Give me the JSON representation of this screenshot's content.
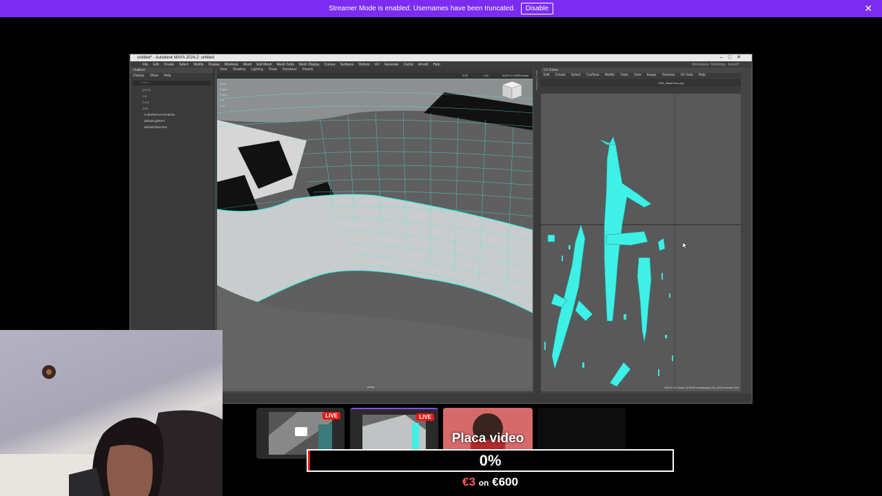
{
  "banner": {
    "message": "Streamer Mode is enabled. Usernames have been truncated.",
    "disable_label": "Disable",
    "close_icon": "close-icon"
  },
  "maya": {
    "title": "untitled* - Autodesk MAYA 2024.2: untitled",
    "menus": [
      "File",
      "Edit",
      "Create",
      "Select",
      "Modify",
      "Display",
      "Windows",
      "Mesh",
      "Edit Mesh",
      "Mesh Tools",
      "Mesh Display",
      "Curves",
      "Surfaces",
      "Deform",
      "UV",
      "Generate",
      "Cache",
      "Arnold",
      "Help"
    ],
    "workspace_label": "Workspace:",
    "workspace_value": "Modeling - Expert*",
    "outliner": {
      "title": "Outliner",
      "menus": [
        "Display",
        "Show",
        "Help"
      ],
      "search_placeholder": "Search...",
      "items": [
        "persp",
        "top",
        "front",
        "side",
        "CubePBX4ACDA6015",
        "defaultLightSet",
        "defaultObjectSet"
      ]
    },
    "viewport": {
      "menus": [
        "View",
        "Shading",
        "Lighting",
        "Show",
        "Renderer",
        "Panels"
      ],
      "hud": [
        "Verts",
        "Edges",
        "Faces",
        "Tris",
        "UVs"
      ],
      "field_a": "0.00",
      "field_b": "1.00",
      "color_space": "ACES 1.0 SDR-video",
      "camera_label": "persp"
    },
    "uv_editor": {
      "title": "UV Editor",
      "menus": [
        "Edit",
        "Create",
        "Select",
        "Cut/Sew",
        "Modify",
        "Tools",
        "View",
        "Image",
        "Textures",
        "UV Sets",
        "Help"
      ],
      "texture": "1001_BaseColor.png",
      "status": "0/8475 UV shells, (0/1643) overlapping UVs, (0/0) reversed UVs"
    },
    "side_tabs": [
      "Modelling Toolkit"
    ]
  },
  "stream": {
    "cards": [
      {
        "live": "LIVE"
      },
      {
        "live": "LIVE"
      },
      {
        "label": "Placa video"
      }
    ],
    "goal": {
      "percent": "0%",
      "progress": 0.005,
      "current": "€3",
      "on": "on",
      "target": "€600"
    }
  },
  "colors": {
    "banner": "#7b2cf0",
    "live": "#e91916",
    "mesh": "#3ff0e6",
    "progress_fill": "#e91916"
  }
}
